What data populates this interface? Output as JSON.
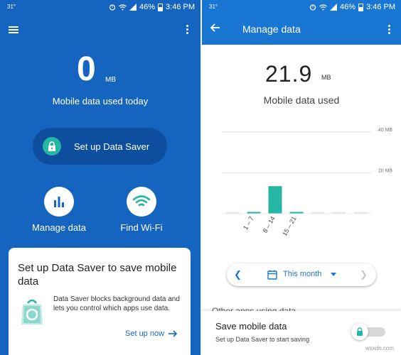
{
  "colors": {
    "primary": "#1565c0",
    "appbar": "#1976d2",
    "accent_teal": "#26b6a4",
    "pill_dark": "#0d4f9e"
  },
  "status_bar": {
    "temperature": "31°",
    "battery": "46%",
    "time": "3:46 PM",
    "icons": [
      "alarm-icon",
      "wifi-icon",
      "signal-icon",
      "battery-icon"
    ]
  },
  "home": {
    "menu_icon": "hamburger-menu-icon",
    "overflow_icon": "more-vert-icon",
    "data_value": "0",
    "data_unit": "MB",
    "data_caption": "Mobile data used today",
    "data_saver_button": "Set up Data Saver",
    "actions": [
      {
        "label": "Manage data",
        "icon": "bar-chart-icon"
      },
      {
        "label": "Find Wi-Fi",
        "icon": "wifi-icon"
      }
    ],
    "card": {
      "title": "Set up Data Saver to save mobile data",
      "description": "Data Saver blocks background data and lets you control which apps use data.",
      "action": "Set up now"
    }
  },
  "manage": {
    "back_icon": "arrow-back-icon",
    "title": "Manage data",
    "overflow_icon": "more-vert-icon",
    "data_value": "21.9",
    "data_unit": "MB",
    "data_caption": "Mobile data used",
    "pager": {
      "period": "This month",
      "prev_icon": "chevron-left-icon",
      "next_icon": "chevron-right-icon",
      "calendar_icon": "calendar-icon"
    },
    "partial_heading": "Other apps using data",
    "save_panel": {
      "title": "Save mobile data",
      "subtitle": "Set up Data Saver to start saving",
      "toggle_on": false
    }
  },
  "chart_data": {
    "type": "bar",
    "categories": [
      "",
      "1 – 7",
      "8 – 14",
      "15 – 21",
      "",
      "",
      ""
    ],
    "values": [
      0,
      0.4,
      13.5,
      0.3,
      0,
      0,
      0
    ],
    "highlight": [
      false,
      true,
      true,
      true,
      false,
      false,
      false
    ],
    "ylim": [
      0,
      40
    ],
    "y_ticks": [
      {
        "value": 20,
        "label": "20 MB"
      },
      {
        "value": 40,
        "label": "40 MB"
      }
    ],
    "grid": true
  },
  "watermark": "wsxdn.com"
}
